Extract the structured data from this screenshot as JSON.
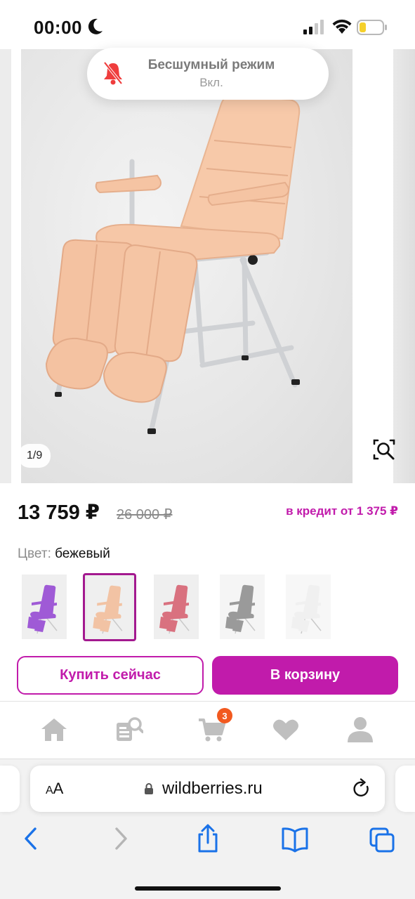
{
  "status_bar": {
    "time": "00:00"
  },
  "toast": {
    "title": "Бесшумный режим",
    "subtitle": "Вкл."
  },
  "gallery": {
    "counter": "1/9"
  },
  "product": {
    "price": "13 759 ₽",
    "old_price": "26 000 ₽",
    "credit": "в кредит от 1 375 ₽",
    "color_label": "Цвет:",
    "color_value": "бежевый",
    "swatches": [
      {
        "color": "#9f5ad6"
      },
      {
        "color": "#f2c3a4"
      },
      {
        "color": "#d9717f"
      },
      {
        "color": "#9a9a9a"
      },
      {
        "color": "#f0f0f0"
      }
    ],
    "accent_color": "#c11bab"
  },
  "actions": {
    "buy_now": "Купить сейчас",
    "add_to_cart": "В корзину"
  },
  "app_nav": {
    "cart_count": "3"
  },
  "browser": {
    "aa_small": "A",
    "aa_large": "A",
    "url": "wildberries.ru"
  }
}
